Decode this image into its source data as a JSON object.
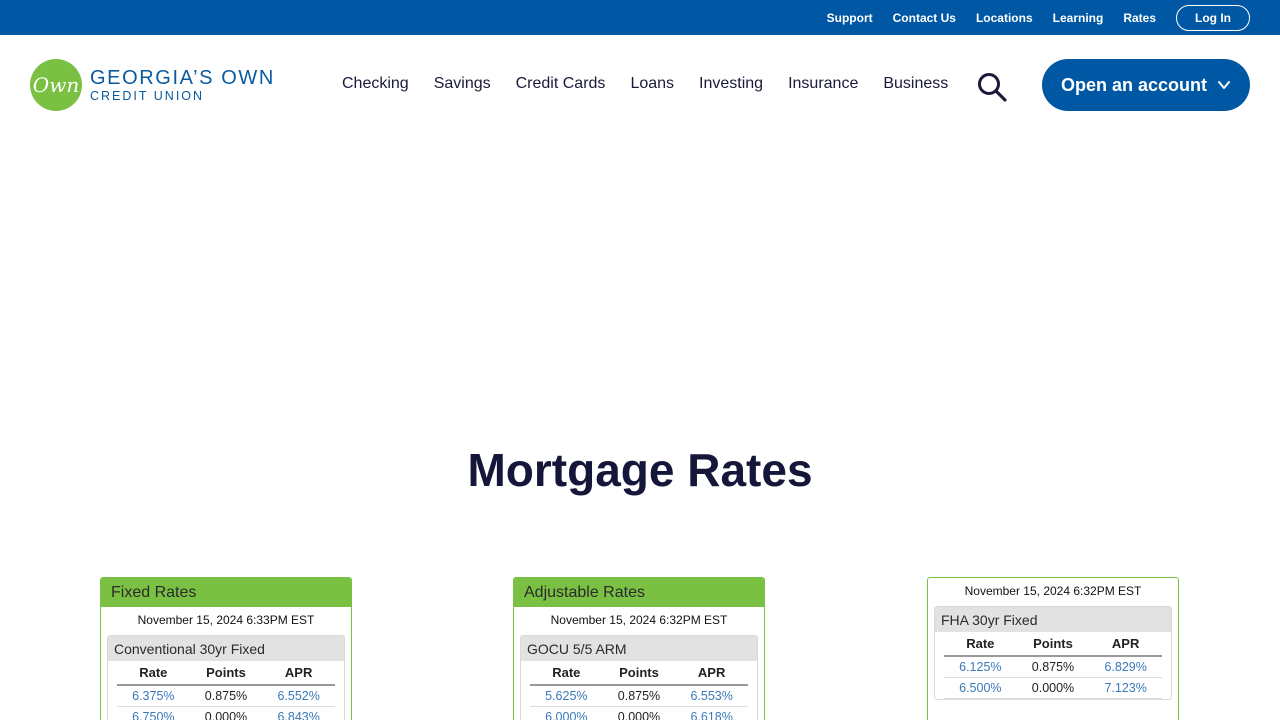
{
  "utility_nav": {
    "links": [
      "Support",
      "Contact Us",
      "Locations",
      "Learning",
      "Rates"
    ],
    "login_label": "Log In"
  },
  "brand": {
    "logo_mark": "Own",
    "name_line1": "GEORGIA’S OWN",
    "name_line2": "CREDIT UNION",
    "colors": {
      "primary": "#0057a3",
      "accent": "#7ac143"
    }
  },
  "main_nav": {
    "items": [
      "Checking",
      "Savings",
      "Credit Cards",
      "Loans",
      "Investing",
      "Insurance",
      "Business"
    ],
    "search_icon": "search-icon",
    "cta_label": "Open an account"
  },
  "page": {
    "title": "Mortgage Rates"
  },
  "widgets": [
    {
      "header": "Fixed Rates",
      "date": "November 15, 2024 6:33PM EST",
      "product": "Conventional 30yr Fixed",
      "columns": [
        "Rate",
        "Points",
        "APR"
      ],
      "rows": [
        [
          "6.375%",
          "0.875%",
          "6.552%"
        ],
        [
          "6.750%",
          "0.000%",
          "6.843%"
        ]
      ]
    },
    {
      "header": "Adjustable Rates",
      "date": "November 15, 2024 6:32PM EST",
      "product": "GOCU 5/5 ARM",
      "columns": [
        "Rate",
        "Points",
        "APR"
      ],
      "rows": [
        [
          "5.625%",
          "0.875%",
          "6.553%"
        ],
        [
          "6.000%",
          "0.000%",
          "6.618%"
        ]
      ]
    },
    {
      "header": "",
      "date": "November 15, 2024 6:32PM EST",
      "product": "FHA 30yr Fixed",
      "columns": [
        "Rate",
        "Points",
        "APR"
      ],
      "rows": [
        [
          "6.125%",
          "0.875%",
          "6.829%"
        ],
        [
          "6.500%",
          "0.000%",
          "7.123%"
        ]
      ]
    }
  ]
}
